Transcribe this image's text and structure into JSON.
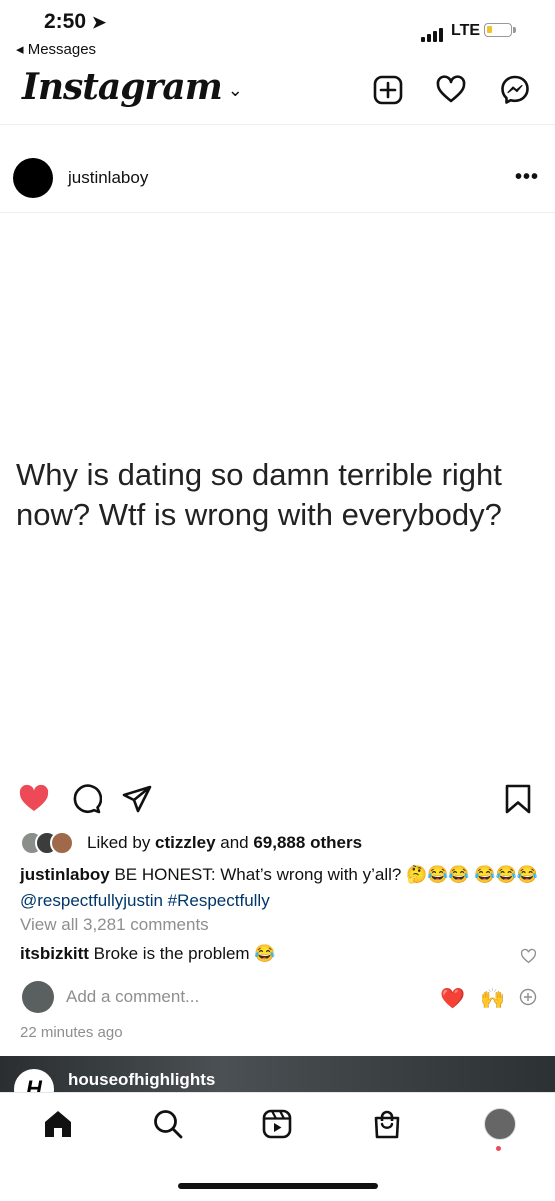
{
  "status_bar": {
    "time": "2:50",
    "back_label": "◂ Messages",
    "network": "LTE",
    "battery_level": 0.25
  },
  "header": {
    "logo": "Instagram"
  },
  "post": {
    "username": "justinlaboy",
    "more_label": "•••",
    "text": "Why is dating so damn terrible right now? Wtf is wrong with everybody?",
    "liked_prefix": "Liked by ",
    "liked_user": "ctizzley",
    "liked_middle": " and ",
    "liked_count": "69,888 others",
    "caption_user": "justinlaboy",
    "caption_text": " BE HONEST: What’s wrong with y’all? 🤔😂😂 😂😂😂 ",
    "caption_mention": "@respectfullyjustin",
    "caption_hashtag": " #Respectfully",
    "view_all_comments": "View all 3,281 comments",
    "comment_user": "itsbizkitt",
    "comment_text": " Broke is the problem 😂",
    "add_comment_placeholder": "Add a comment...",
    "quick_reaction_1": "❤️",
    "quick_reaction_2": "🙌",
    "timestamp": "22 minutes ago"
  },
  "next_post": {
    "username": "houseofhighlights"
  },
  "colors": {
    "like_red": "#ed4956",
    "link_blue": "#00376b",
    "muted_gray": "#8e8e8e"
  },
  "icons": [
    "new-post-icon",
    "heart-icon",
    "messenger-icon",
    "like-icon",
    "comment-icon",
    "share-icon",
    "bookmark-icon",
    "home-icon",
    "search-icon",
    "reels-icon",
    "shop-icon"
  ]
}
